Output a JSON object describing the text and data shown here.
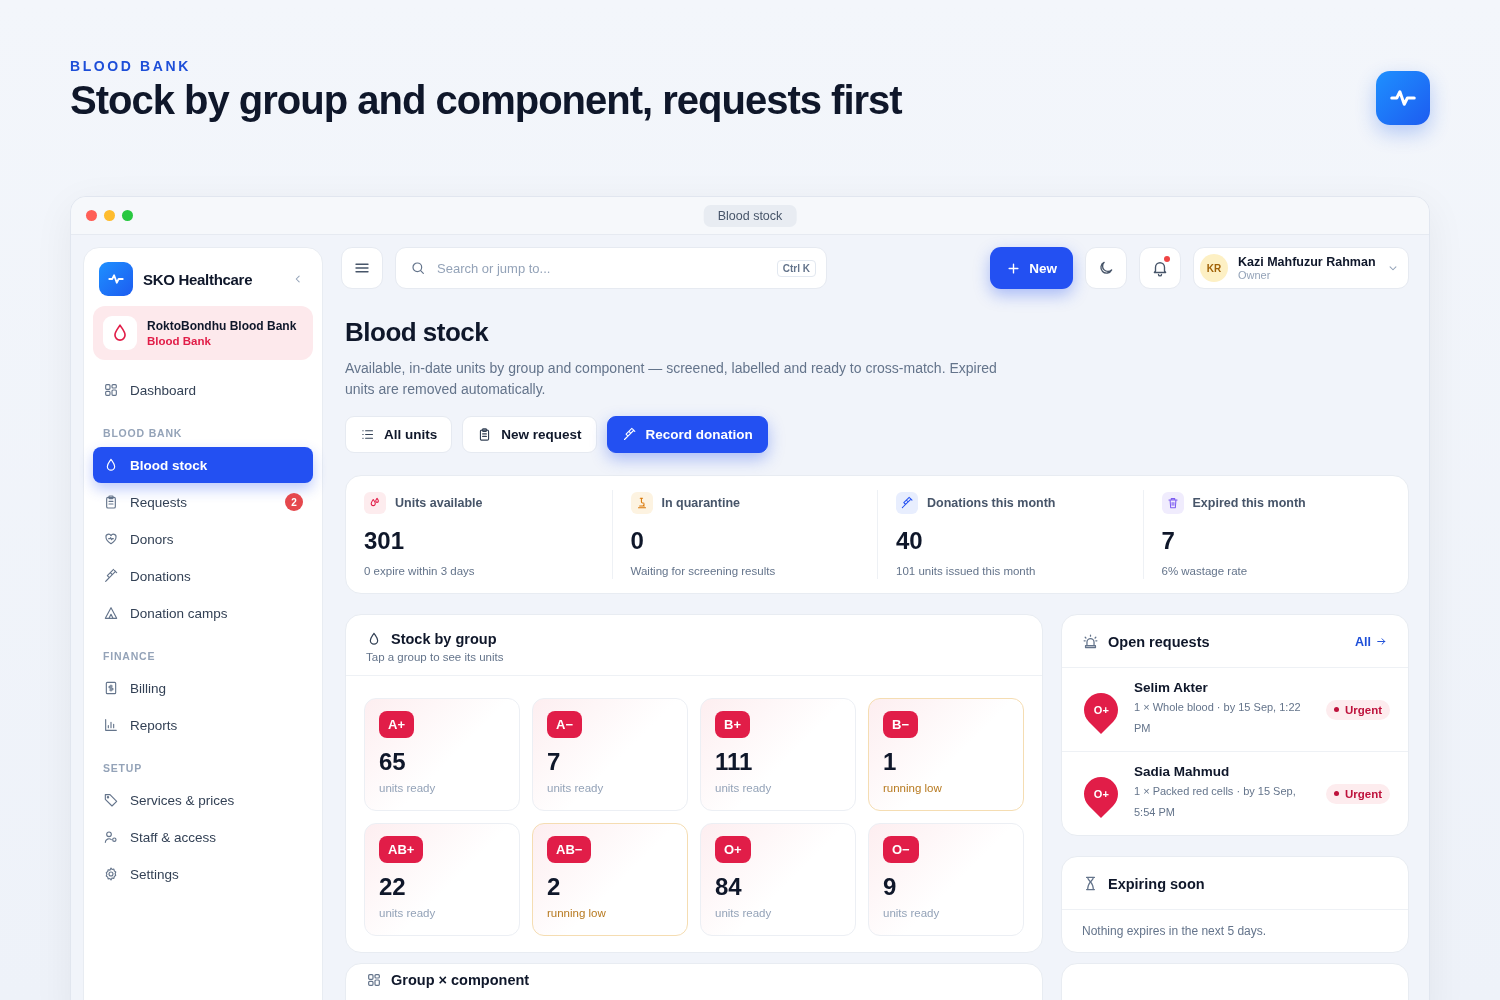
{
  "header": {
    "eyebrow": "BLOOD BANK",
    "title": "Stock by group and component, requests first"
  },
  "window": {
    "title": "Blood stock"
  },
  "sidebar": {
    "brand": "SKO Healthcare",
    "org": {
      "name": "RoktoBondhu Blood Bank",
      "type": "Blood Bank"
    },
    "sections": [
      {
        "items": [
          {
            "label": "Dashboard",
            "selected": false
          }
        ]
      },
      {
        "heading": "BLOOD BANK",
        "items": [
          {
            "label": "Blood stock",
            "selected": true
          },
          {
            "label": "Requests",
            "selected": false,
            "badge": "2"
          },
          {
            "label": "Donors",
            "selected": false
          },
          {
            "label": "Donations",
            "selected": false
          },
          {
            "label": "Donation camps",
            "selected": false
          }
        ]
      },
      {
        "heading": "FINANCE",
        "items": [
          {
            "label": "Billing",
            "selected": false
          },
          {
            "label": "Reports",
            "selected": false
          }
        ]
      },
      {
        "heading": "SETUP",
        "items": [
          {
            "label": "Services & prices",
            "selected": false
          },
          {
            "label": "Staff & access",
            "selected": false
          },
          {
            "label": "Settings",
            "selected": false
          }
        ]
      }
    ]
  },
  "topbar": {
    "search": {
      "placeholder": "Search or jump to...",
      "shortcut": "Ctrl K"
    },
    "new_button": "New",
    "has_unread": true,
    "user": {
      "initials": "KR",
      "name": "Kazi Mahfuzur Rahman",
      "role": "Owner"
    }
  },
  "page": {
    "title": "Blood stock",
    "description": "Available, in-date units by group and component — screened, labelled and ready to cross-match. Expired units are removed automatically.",
    "actions": [
      {
        "label": "All units",
        "kind": "default"
      },
      {
        "label": "New request",
        "kind": "default"
      },
      {
        "label": "Record donation",
        "kind": "primary"
      }
    ]
  },
  "stats": [
    {
      "label": "Units available",
      "value": "301",
      "note": "0 expire within 3 days"
    },
    {
      "label": "In quarantine",
      "value": "0",
      "note": "Waiting for screening results"
    },
    {
      "label": "Donations this month",
      "value": "40",
      "note": "101 units issued this month"
    },
    {
      "label": "Expired this month",
      "value": "7",
      "note": "6% wastage rate"
    }
  ],
  "stock": {
    "title": "Stock by group",
    "subtitle": "Tap a group to see its units",
    "groups": [
      {
        "group": "A+",
        "count": "65",
        "note": "units ready",
        "low": false
      },
      {
        "group": "A−",
        "count": "7",
        "note": "units ready",
        "low": false
      },
      {
        "group": "B+",
        "count": "111",
        "note": "units ready",
        "low": false
      },
      {
        "group": "B−",
        "count": "1",
        "note": "running low",
        "low": true
      },
      {
        "group": "AB+",
        "count": "22",
        "note": "units ready",
        "low": false
      },
      {
        "group": "AB−",
        "count": "2",
        "note": "running low",
        "low": true
      },
      {
        "group": "O+",
        "count": "84",
        "note": "units ready",
        "low": false
      },
      {
        "group": "O−",
        "count": "9",
        "note": "units ready",
        "low": false
      }
    ]
  },
  "requests": {
    "title": "Open requests",
    "link": "All",
    "items": [
      {
        "group": "O+",
        "name": "Selim Akter",
        "detail": "1 × Whole blood · by 15 Sep, 1:22 PM",
        "priority": "Urgent"
      },
      {
        "group": "O+",
        "name": "Sadia Mahmud",
        "detail": "1 × Packed red cells · by 15 Sep, 5:54 PM",
        "priority": "Urgent"
      }
    ]
  },
  "expiring": {
    "title": "Expiring soon",
    "message": "Nothing expires in the next 5 days."
  },
  "group_component": {
    "title": "Group × component"
  }
}
